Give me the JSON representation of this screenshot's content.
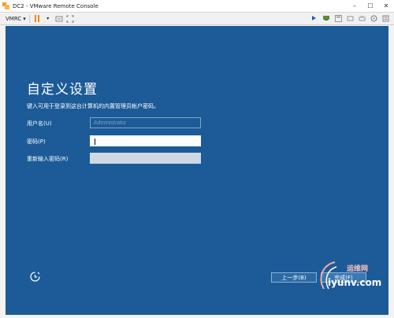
{
  "window": {
    "title": "DC2 - VMware Remote Console"
  },
  "toolbar": {
    "menu_label": "VMRC",
    "menu_arrow": "▾",
    "icons_left": [
      "pause-icon",
      "chevron-down-icon",
      "send-ctrl-alt-del-icon",
      "fit-screen-icon"
    ],
    "icons_right": [
      "connect-icon",
      "network-icon",
      "floppy-icon",
      "usb-icon",
      "printer-icon",
      "cd-icon",
      "settings-icon"
    ]
  },
  "setup": {
    "heading": "自定义设置",
    "instruction": "键入可用于登录到这台计算机的内置管理员帐户密码。",
    "username_label": "用户名(U)",
    "username_value": "Administrator",
    "password_label": "密码(P)",
    "confirm_label": "重新输入密码(R)",
    "back_button": "上一步(B)",
    "finish_button": "完成(F)"
  },
  "watermark": {
    "line1": "运维网",
    "line2": "iyunv.com"
  },
  "colors": {
    "screen_bg": "#1c5b97",
    "button_bg": "#2d6aa5"
  }
}
